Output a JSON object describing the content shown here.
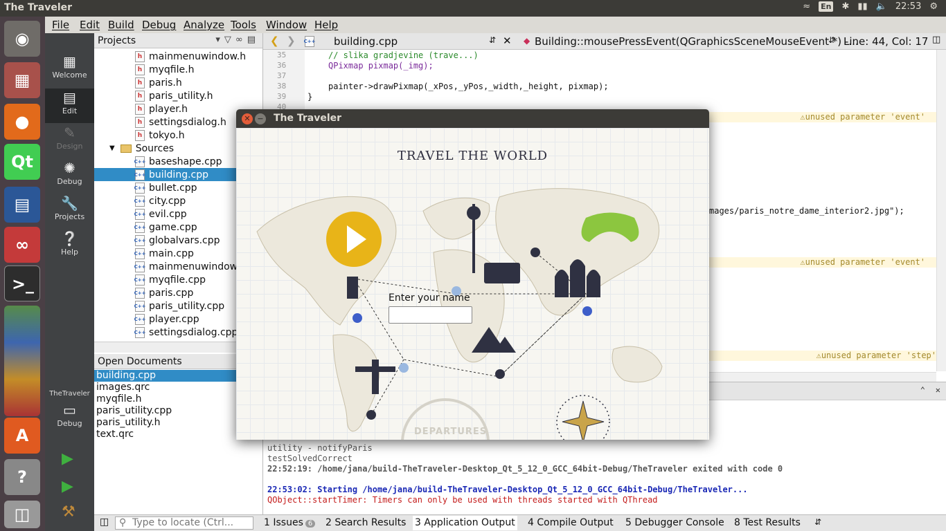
{
  "topbar": {
    "title": "The Traveler",
    "keyboard": "En",
    "clock": "22:53"
  },
  "menu": [
    "File",
    "Edit",
    "Build",
    "Debug",
    "Analyze",
    "Tools",
    "Window",
    "Help"
  ],
  "modes": [
    {
      "label": "Welcome",
      "icon": "grid-icon"
    },
    {
      "label": "Edit",
      "icon": "edit-icon"
    },
    {
      "label": "Design",
      "icon": "design-icon"
    },
    {
      "label": "Debug",
      "icon": "bug-icon"
    },
    {
      "label": "Projects",
      "icon": "wrench-icon"
    },
    {
      "label": "Help",
      "icon": "help-icon"
    }
  ],
  "kit": {
    "project": "TheTraveler",
    "config": "Debug"
  },
  "projects": {
    "title": "Projects",
    "headers": [
      "mainmenuwindow.h",
      "myqfile.h",
      "paris.h",
      "paris_utility.h",
      "player.h",
      "settingsdialog.h",
      "tokyo.h"
    ],
    "sources_label": "Sources",
    "sources": [
      "baseshape.cpp",
      "building.cpp",
      "bullet.cpp",
      "city.cpp",
      "evil.cpp",
      "game.cpp",
      "globalvars.cpp",
      "main.cpp",
      "mainmenuwindow.",
      "myqfile.cpp",
      "paris.cpp",
      "paris_utility.cpp",
      "player.cpp",
      "settingsdialog.cpp"
    ],
    "selected": "building.cpp"
  },
  "open_documents": {
    "title": "Open Documents",
    "items": [
      "building.cpp",
      "images.qrc",
      "myqfile.h",
      "paris_utility.cpp",
      "paris_utility.h",
      "text.qrc"
    ]
  },
  "editor": {
    "file": "building.cpp",
    "function": "Building::mousePressEvent(QGraphicsSceneMouseEvent *) -...",
    "position": "Line: 44, Col: 17",
    "lines": [
      {
        "n": "35",
        "text": "// slika gradjevine (trave...)"
      },
      {
        "n": "36",
        "text": "QPixmap pixmap(_img);"
      },
      {
        "n": "37",
        "text": ""
      },
      {
        "n": "38",
        "text": "painter->drawPixmap(_xPos,_yPos,_width,_height, pixmap);"
      },
      {
        "n": "39",
        "text": "}"
      },
      {
        "n": "40",
        "text": ""
      }
    ],
    "snippet": "mages/paris_notre_dame_interior2.jpg\");",
    "warnings": [
      "unused parameter 'event'",
      "unused parameter 'event'",
      "unused parameter 'step'"
    ]
  },
  "output": {
    "lines": [
      "utility - notifyParis",
      "testSolvedCorrect",
      "22:52:19: /home/jana/build-TheTraveler-Desktop_Qt_5_12_0_GCC_64bit-Debug/TheTraveler exited with code 0",
      "22:53:02: Starting /home/jana/build-TheTraveler-Desktop_Qt_5_12_0_GCC_64bit-Debug/TheTraveler...",
      "QObject::startTimer: Timers can only be used with threads started with QThread"
    ]
  },
  "statusbar": {
    "locate_placeholder": "Type to locate (Ctrl...",
    "tabs": [
      {
        "num": "1",
        "label": "Issues",
        "badge": "6"
      },
      {
        "num": "2",
        "label": "Search Results"
      },
      {
        "num": "3",
        "label": "Application Output"
      },
      {
        "num": "4",
        "label": "Compile Output"
      },
      {
        "num": "5",
        "label": "Debugger Console"
      },
      {
        "num": "8",
        "label": "Test Results"
      }
    ]
  },
  "app_window": {
    "title": "The Traveler",
    "heading": "TRAVEL THE WORLD",
    "name_label": "Enter your name",
    "name_value": "",
    "stamp_text": "DEPARTURES"
  },
  "colors": {
    "accent_play": "#e8b418",
    "gamepad": "#8cc63f",
    "pin_blue": "#3e5ec9",
    "selection": "#308cc6"
  }
}
